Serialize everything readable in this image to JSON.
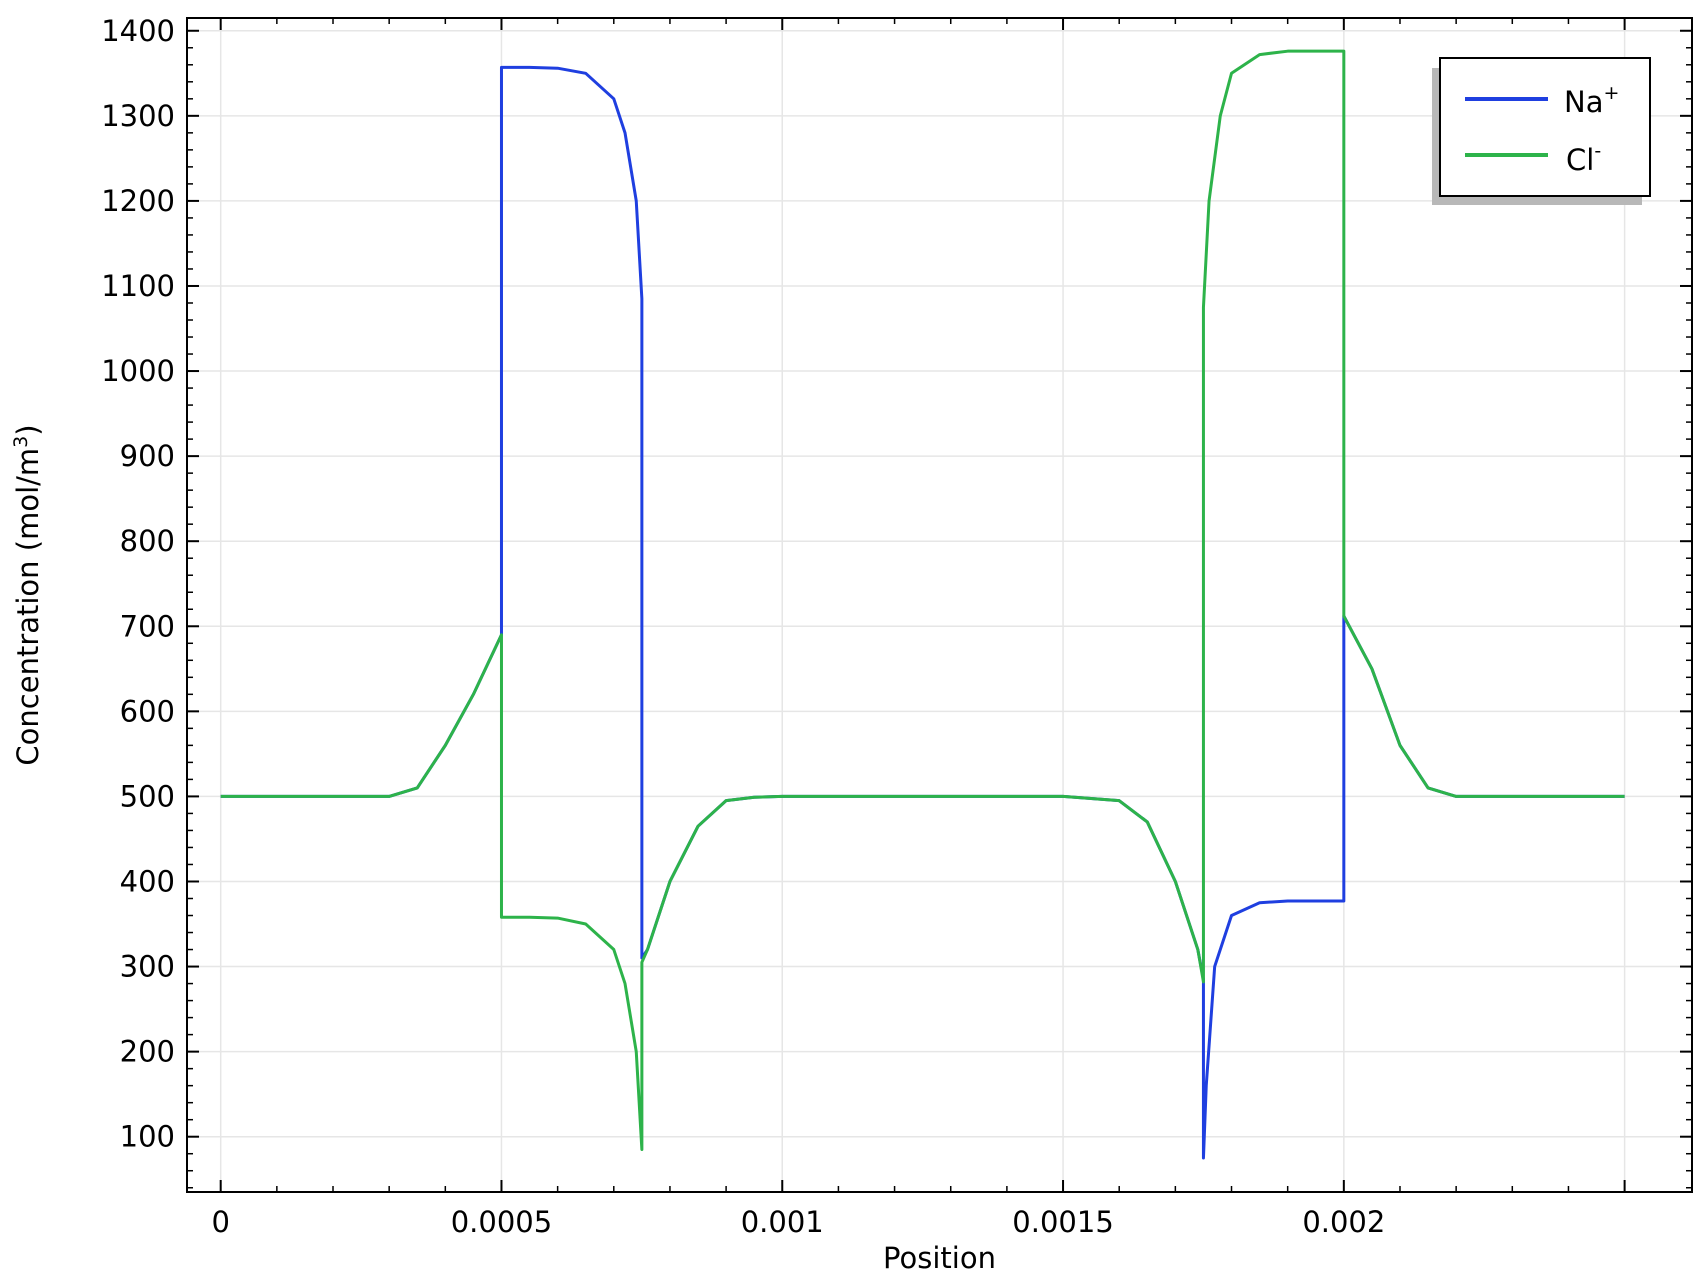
{
  "chart_data": {
    "type": "line",
    "xlabel": "Position",
    "ylabel": "Concentration (mol/m",
    "ylabel_sup": "3",
    "ylabel_end": ")",
    "xlim": [
      -6e-05,
      0.00262
    ],
    "ylim": [
      35,
      1415
    ],
    "x_ticks": [
      0,
      0.0005,
      0.001,
      0.0015,
      0.002
    ],
    "x_tick_labels": [
      "0",
      "0.0005",
      "0.001",
      "0.0015",
      "0.002"
    ],
    "y_ticks": [
      100,
      200,
      300,
      400,
      500,
      600,
      700,
      800,
      900,
      1000,
      1100,
      1200,
      1300,
      1400
    ],
    "y_tick_labels": [
      "100",
      "200",
      "300",
      "400",
      "500",
      "600",
      "700",
      "800",
      "900",
      "1000",
      "1100",
      "1200",
      "1300",
      "1400"
    ],
    "grid": true,
    "legend_position": "top-right",
    "series": [
      {
        "name": "Na",
        "name_sup": "+",
        "color": "#1f3fe0",
        "x": [
          0,
          0.0003,
          0.00035,
          0.0004,
          0.00045,
          0.0005,
          0.0005,
          0.00055,
          0.0006,
          0.00065,
          0.0007,
          0.00072,
          0.00074,
          0.00075,
          0.00075,
          0.00076,
          0.0008,
          0.00085,
          0.0009,
          0.00095,
          0.001,
          0.0015,
          0.0016,
          0.00165,
          0.0017,
          0.00174,
          0.00175,
          0.00175,
          0.001755,
          0.00177,
          0.0018,
          0.00185,
          0.0019,
          0.002,
          0.002,
          0.00205,
          0.0021,
          0.00215,
          0.0022,
          0.0025
        ],
        "values": [
          500,
          500,
          510,
          560,
          620,
          690,
          1357,
          1357,
          1356,
          1350,
          1320,
          1280,
          1200,
          1085,
          310,
          320,
          400,
          465,
          495,
          499,
          500,
          500,
          495,
          470,
          400,
          320,
          285,
          75,
          160,
          300,
          360,
          375,
          377,
          377,
          712,
          650,
          560,
          510,
          500,
          500
        ]
      },
      {
        "name": "Cl",
        "name_sup": "-",
        "color": "#2db34a",
        "x": [
          0,
          0.0003,
          0.00035,
          0.0004,
          0.00045,
          0.0005,
          0.0005,
          0.00055,
          0.0006,
          0.00065,
          0.0007,
          0.00072,
          0.00074,
          0.00075,
          0.00075,
          0.00076,
          0.0008,
          0.00085,
          0.0009,
          0.00095,
          0.001,
          0.0015,
          0.0016,
          0.00165,
          0.0017,
          0.00174,
          0.00175,
          0.00175,
          0.00176,
          0.00178,
          0.0018,
          0.00185,
          0.0019,
          0.002,
          0.002,
          0.00205,
          0.0021,
          0.00215,
          0.0022,
          0.0025
        ],
        "values": [
          500,
          500,
          510,
          560,
          620,
          690,
          358,
          358,
          357,
          350,
          320,
          280,
          200,
          85,
          305,
          320,
          400,
          465,
          495,
          499,
          500,
          500,
          495,
          470,
          400,
          320,
          282,
          1075,
          1200,
          1300,
          1350,
          1372,
          1376,
          1376,
          712,
          650,
          560,
          510,
          500,
          500
        ]
      }
    ]
  }
}
